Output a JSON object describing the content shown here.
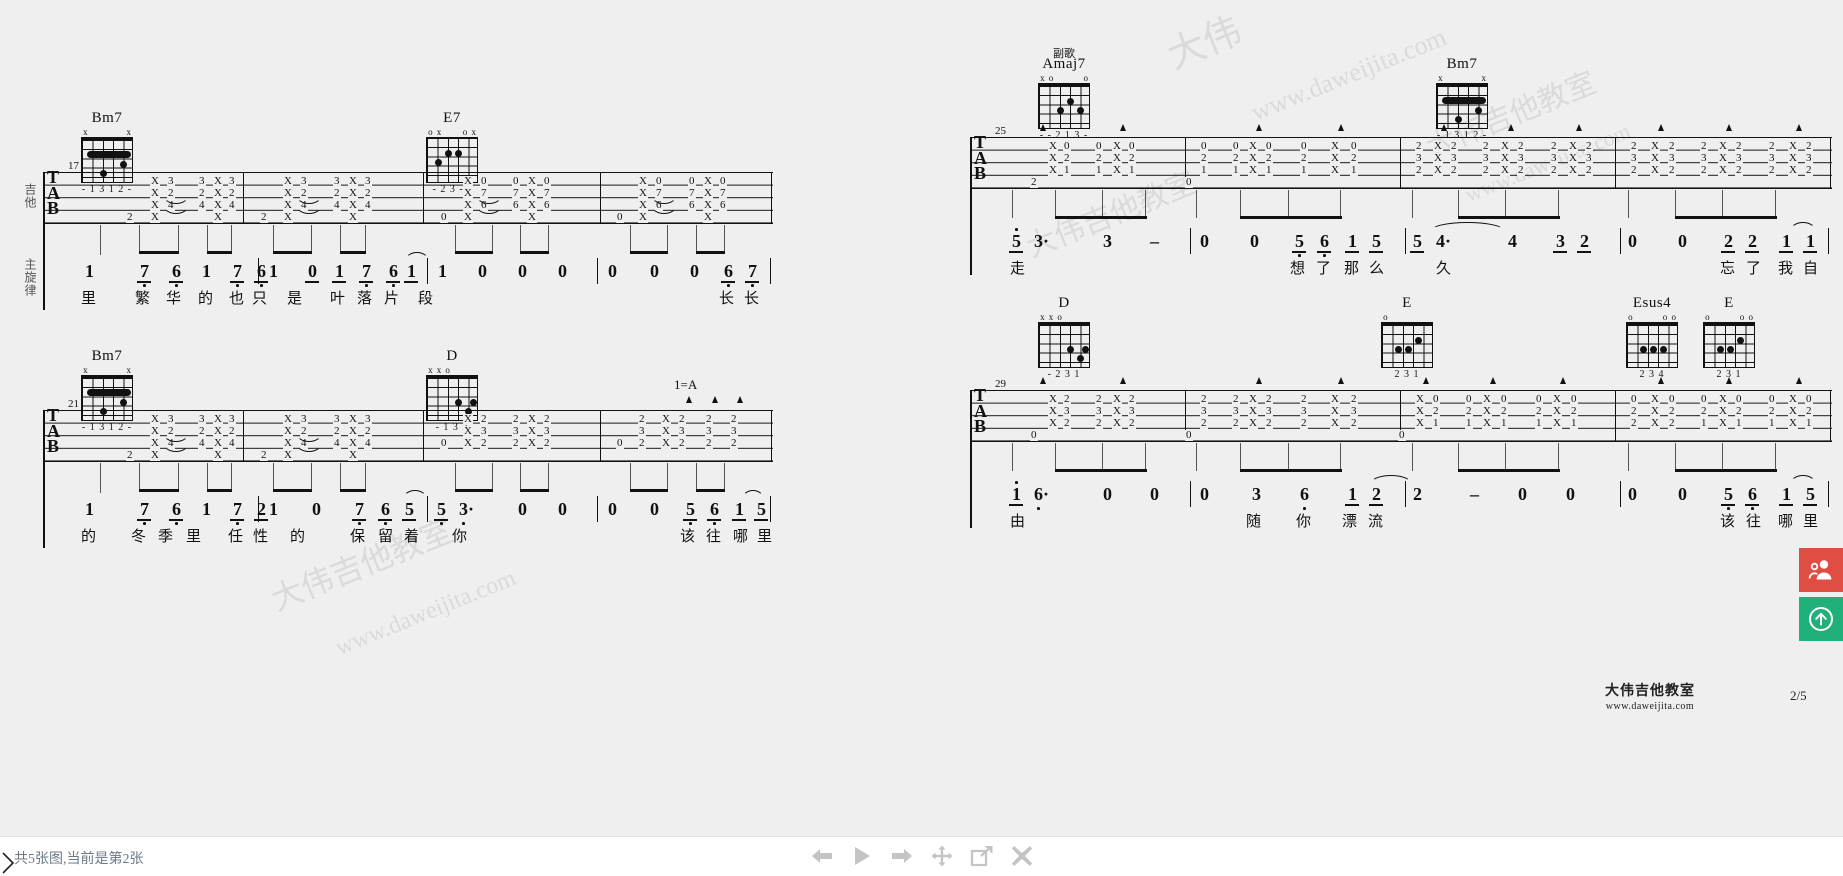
{
  "viewer": {
    "status_text": "共5张图,当前是第2张",
    "toolbar": [
      {
        "name": "prev-image-button",
        "label": "上一张",
        "icon": "arrow-left-icon"
      },
      {
        "name": "play-slideshow-button",
        "label": "播放",
        "icon": "play-icon"
      },
      {
        "name": "next-image-button",
        "label": "下一张",
        "icon": "arrow-right-icon"
      },
      {
        "name": "pan-button",
        "label": "拖动",
        "icon": "move-icon"
      },
      {
        "name": "open-original-button",
        "label": "查看原图",
        "icon": "open-external-icon"
      },
      {
        "name": "close-button",
        "label": "关闭",
        "icon": "close-icon"
      }
    ],
    "left_chevron": "›",
    "colors": {
      "page_background": "#efefef",
      "bar_background": "#ffffff",
      "status_text": "#6d7a86",
      "toolbar_icon": "#c4c4c4",
      "fab_red": "#e04e43",
      "fab_green": "#20b07a",
      "ink": "#111111"
    }
  },
  "fabs": [
    {
      "name": "share-group-fab",
      "icon": "people-icon",
      "color": "#e04e43"
    },
    {
      "name": "back-to-top-fab",
      "icon": "arrow-up-circle-icon",
      "color": "#20b07a"
    }
  ],
  "sheet": {
    "footer": {
      "brand_cn": "大伟吉他教室",
      "brand_url": "www.daweijita.com",
      "page_indicator": "2/5"
    },
    "labels": {
      "guitar": "吉他",
      "melody": "主旋律",
      "key_change": "1=A",
      "section_chorus": "副歌"
    },
    "watermarks": [
      "大伟",
      "www.daweijita.com",
      "大伟吉他教室",
      "www.daweijita.com"
    ],
    "chords": [
      {
        "id": "c1",
        "name": "Bm7",
        "fret_label": "",
        "open_marks": [
          "x",
          "",
          "",
          "",
          "",
          "x"
        ],
        "fingering": "- 1 3 1 2 -",
        "barre": {
          "from": 1,
          "to": 5,
          "fret": 2
        },
        "dots": [
          [
            0,
            2
          ],
          [
            1,
            4
          ],
          [
            3,
            4
          ]
        ]
      },
      {
        "id": "c2",
        "name": "E7",
        "fret_label": "",
        "open_marks": [
          "o",
          "x",
          "",
          "",
          "o",
          "x"
        ],
        "fingering": "- 2 3 - -",
        "dots": [
          [
            1,
            2
          ],
          [
            1,
            4
          ],
          [
            0,
            3
          ]
        ]
      },
      {
        "id": "c3",
        "name": "Bm7",
        "fret_label": "",
        "open_marks": [
          "x",
          "",
          "",
          "",
          "",
          "x"
        ],
        "fingering": "- 1 3 1 2 -",
        "barre": {
          "from": 1,
          "to": 5,
          "fret": 2
        },
        "dots": [
          [
            0,
            2
          ],
          [
            1,
            4
          ],
          [
            3,
            4
          ]
        ]
      },
      {
        "id": "c4",
        "name": "D",
        "fret_label": "",
        "open_marks": [
          "x",
          "x",
          "o",
          "",
          "",
          ""
        ],
        "fingering": "- 1 3 2",
        "dots": [
          [
            1,
            3
          ],
          [
            2,
            4
          ],
          [
            1,
            5
          ]
        ]
      },
      {
        "id": "c5",
        "name": "Amaj7",
        "fret_label": "",
        "section": "副歌",
        "open_marks": [
          "x",
          "o",
          "",
          "",
          "",
          "o"
        ],
        "fingering": "- - 2 1 3 -",
        "dots": [
          [
            1,
            3
          ],
          [
            0,
            4
          ],
          [
            1,
            5
          ]
        ]
      },
      {
        "id": "c6",
        "name": "Bm7",
        "fret_label": "",
        "open_marks": [
          "x",
          "",
          "",
          "",
          "",
          "x"
        ],
        "fingering": "- 1 3 1 2 -",
        "barre": {
          "from": 1,
          "to": 5,
          "fret": 2
        },
        "dots": [
          [
            0,
            2
          ],
          [
            1,
            4
          ],
          [
            3,
            4
          ]
        ]
      },
      {
        "id": "c7",
        "name": "D",
        "fret_label": "",
        "open_marks": [
          "x",
          "x",
          "o",
          "",
          "",
          ""
        ],
        "fingering": "- 2 3 1",
        "dots": [
          [
            1,
            3
          ],
          [
            2,
            4
          ],
          [
            1,
            5
          ]
        ]
      },
      {
        "id": "c8",
        "name": "E",
        "fret_label": "",
        "open_marks": [
          "o",
          "",
          "",
          "",
          "",
          ""
        ],
        "fingering": "2 3 1",
        "dots": [
          [
            1,
            2
          ],
          [
            1,
            3
          ],
          [
            0,
            4
          ]
        ]
      },
      {
        "id": "c9",
        "name": "Esus4",
        "fret_label": "",
        "open_marks": [
          "o",
          "",
          "",
          "",
          "o",
          "o"
        ],
        "fingering": "2 3 4",
        "dots": [
          [
            1,
            2
          ],
          [
            1,
            3
          ],
          [
            1,
            4
          ]
        ]
      },
      {
        "id": "c10",
        "name": "E",
        "fret_label": "",
        "open_marks": [
          "o",
          "",
          "",
          "",
          "o",
          "o"
        ],
        "fingering": "2 3 1",
        "dots": [
          [
            1,
            2
          ],
          [
            1,
            3
          ],
          [
            0,
            4
          ]
        ]
      }
    ],
    "systems": [
      {
        "id": "system-1",
        "measure_number": "17",
        "jianpu": "1  7 6  1  7 6 | 1  0 1  7 6  1 | 1  0  0  0 | 0  0  0  6 7",
        "lyrics": "里  繁华 的  也只 是  叶落片 段                             长长",
        "chord_names": [
          "Bm7",
          "E7"
        ]
      },
      {
        "id": "system-2",
        "measure_number": "21",
        "jianpu": "1  7 6  1  7 2 | 1  0 7 6  5  5 3· | 0  0 | 0  0  5 6  1 5",
        "lyrics": "的  冬季里  任性  的  保留  着  你                 该往 哪里",
        "chord_names": [
          "Bm7",
          "D"
        ],
        "key_change": "1=A"
      },
      {
        "id": "system-3",
        "measure_number": "25",
        "jianpu": "5 3·  3  − | 0  0  5 6  1 5 | 5 4·  4  3 2 | 0  0  2 2  1 1",
        "lyrics": "走                    想了 那么  久              忘了 我自",
        "chord_names": [
          "Amaj7",
          "Bm7"
        ],
        "section": "副歌"
      },
      {
        "id": "system-4",
        "measure_number": "29",
        "jianpu": "1 6·  0  0 | 0  3  6  1 2 | 2  −  0  0 | 0  0  5 6  1 5",
        "lyrics": "由              随  你  漂流                    该往 哪里",
        "chord_names": [
          "D",
          "E",
          "Esus4",
          "E"
        ]
      }
    ],
    "tab_numbers": {
      "system1": "X-3 3-X-3 | 3-X-3 3-X-3 | X-0 0-X-0 | 0-X-0 0-X-0 (2 bass)",
      "system2": "X-3 3-X-3 | 3-X-3 3-X-3 | X-2 2-X-2 | 2-X-2 2-X-2 (2 bass)",
      "system3": "X-0 0-X-0 | X-0 0-X-0 | 2-X-2 2-X-2 | 2-X-2 2-X-2",
      "system4": "X-2 2-X-2 | X-2 2-X-2 | X-0 0-X-0 | X-0 0-X-0"
    }
  }
}
